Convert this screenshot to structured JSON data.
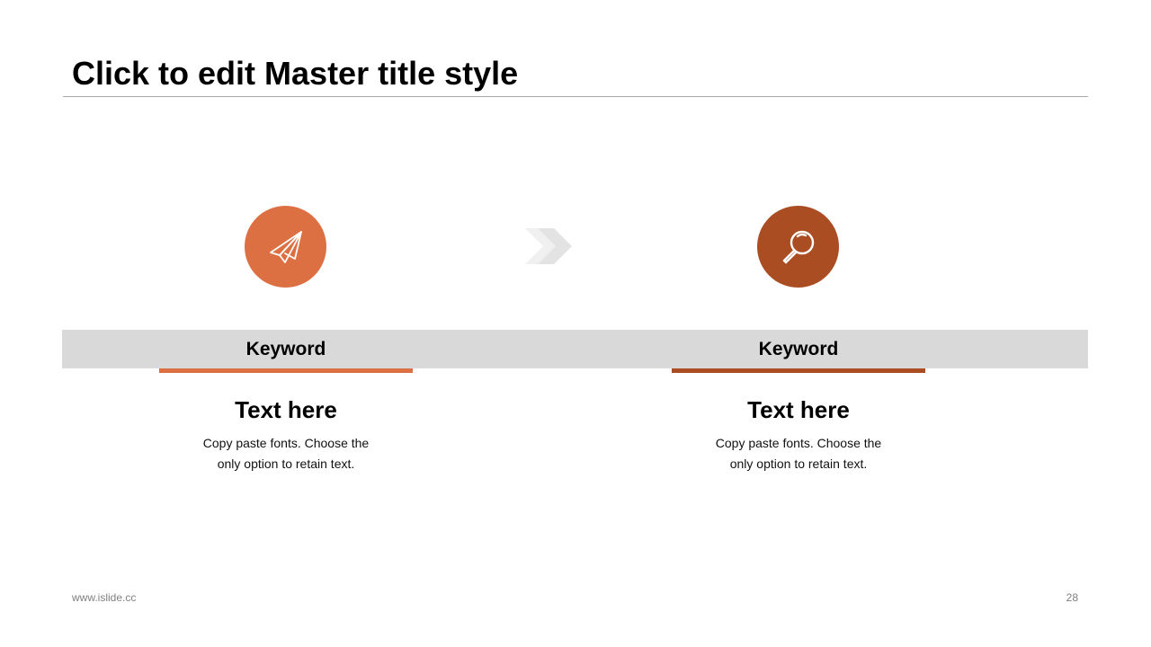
{
  "slide": {
    "title": "Click to edit Master title style"
  },
  "steps": [
    {
      "icon": "paper-plane-icon",
      "color": "#dc7042",
      "keyword": "Keyword",
      "heading": "Text here",
      "body": "Copy paste fonts. Choose the only option to retain text."
    },
    {
      "icon": "magnifier-icon",
      "color": "#ab4d22",
      "keyword": "Keyword",
      "heading": "Text here",
      "body": "Copy paste fonts. Choose the only option to retain text."
    }
  ],
  "connector": {
    "icon": "chevron-right-icon",
    "color": "#e6e6e6"
  },
  "band_color": "#d9d9d9",
  "footer": {
    "url": "www.islide.cc",
    "page_number": "28"
  }
}
